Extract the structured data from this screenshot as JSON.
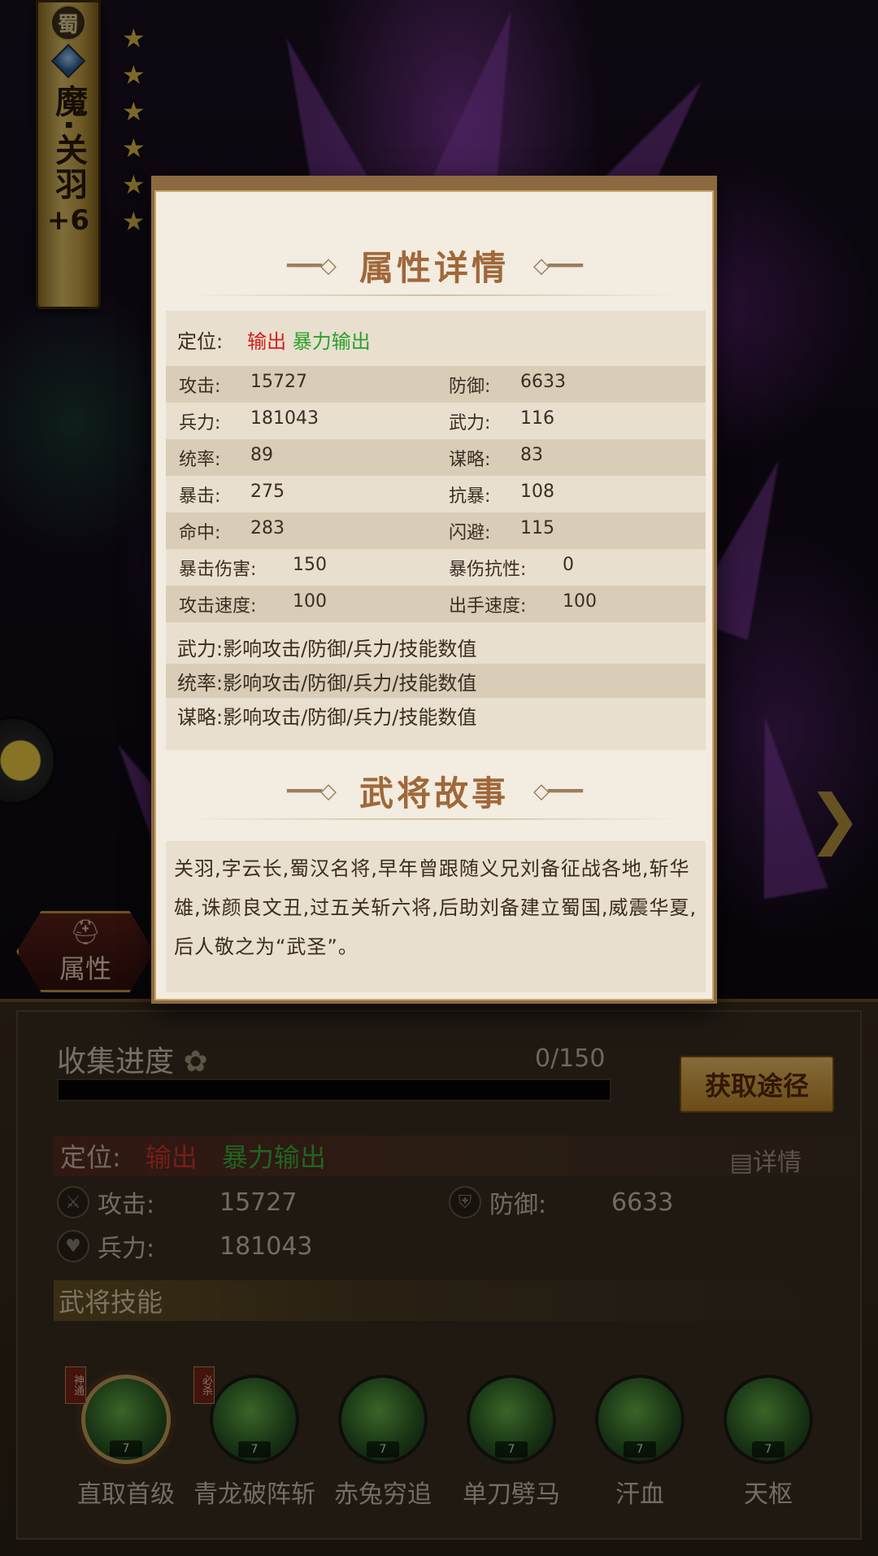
{
  "hero": {
    "kingdom": "蜀",
    "name": "魔·关羽",
    "plus": "+6",
    "stars": 6
  },
  "side_tab": {
    "label": "属性"
  },
  "popup": {
    "attr_title": "属性详情",
    "role_label": "定位:",
    "role_primary": "输出",
    "role_secondary": "暴力输出",
    "stats": [
      {
        "l1": "攻击:",
        "v1": "15727",
        "l2": "防御:",
        "v2": "6633"
      },
      {
        "l1": "兵力:",
        "v1": "181043",
        "l2": "武力:",
        "v2": "116"
      },
      {
        "l1": "统率:",
        "v1": "89",
        "l2": "谋略:",
        "v2": "83"
      },
      {
        "l1": "暴击:",
        "v1": "275",
        "l2": "抗暴:",
        "v2": "108"
      },
      {
        "l1": "命中:",
        "v1": "283",
        "l2": "闪避:",
        "v2": "115"
      },
      {
        "l1": "暴击伤害:",
        "v1": "150",
        "l2": "暴伤抗性:",
        "v2": "0"
      },
      {
        "l1": "攻击速度:",
        "v1": "100",
        "l2": "出手速度:",
        "v2": "100"
      }
    ],
    "descs": [
      "武力:影响攻击/防御/兵力/技能数值",
      "统率:影响攻击/防御/兵力/技能数值",
      "谋略:影响攻击/防御/兵力/技能数值"
    ],
    "story_title": "武将故事",
    "story": "关羽,字云长,蜀汉名将,早年曾跟随义兄刘备征战各地,斩华雄,诛颜良文丑,过五关斩六将,后助刘备建立蜀国,威震华夏,后人敬之为“武圣”。"
  },
  "lower": {
    "collect_title": "收集进度",
    "collect_count": "0/150",
    "collect_progress": 0,
    "get_button": "获取途径",
    "role_label": "定位:",
    "role_primary": "输出",
    "role_secondary": "暴力输出",
    "detail_label": "详情",
    "attack_label": "攻击:",
    "attack_value": "15727",
    "defense_label": "防御:",
    "defense_value": "6633",
    "troops_label": "兵力:",
    "troops_value": "181043",
    "skills_title": "武将技能",
    "skills": [
      {
        "name": "直取首级",
        "level": "7",
        "tag": "神通"
      },
      {
        "name": "青龙破阵斩",
        "level": "7",
        "tag": "必杀"
      },
      {
        "name": "赤兔穷追",
        "level": "7",
        "tag": ""
      },
      {
        "name": "单刀劈马",
        "level": "7",
        "tag": ""
      },
      {
        "name": "汗血",
        "level": "7",
        "tag": ""
      },
      {
        "name": "天枢",
        "level": "7",
        "tag": ""
      }
    ]
  },
  "colors": {
    "accent_red": "#d0201c",
    "accent_green": "#2aa02a",
    "title_brown": "#a0683a",
    "gold": "#e6b040"
  }
}
